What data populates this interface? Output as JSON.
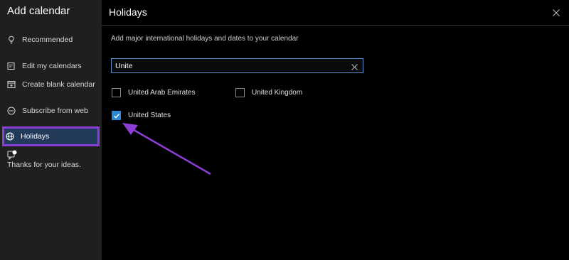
{
  "sidebar": {
    "title": "Add calendar",
    "items": [
      {
        "label": "Recommended",
        "icon": "lightbulb-icon"
      },
      {
        "label": "Edit my calendars",
        "icon": "edit-calendar-icon"
      },
      {
        "label": "Create blank calendar",
        "icon": "blank-calendar-icon"
      },
      {
        "label": "Subscribe from web",
        "icon": "subscribe-icon"
      },
      {
        "label": "Holidays",
        "icon": "globe-icon",
        "active": true
      }
    ],
    "feedback_text": "Thanks for your ideas."
  },
  "main": {
    "title": "Holidays",
    "description": "Add major international holidays and dates to your calendar",
    "search": {
      "value": "Unite"
    },
    "options": [
      {
        "label": "United Arab Emirates",
        "checked": false
      },
      {
        "label": "United Kingdom",
        "checked": false
      },
      {
        "label": "United States",
        "checked": true
      }
    ]
  },
  "colors": {
    "accent": "#2b88d8",
    "highlight_border": "#8c3fd6",
    "active_bg": "#243a5a",
    "annotation_arrow": "#8c3fd6"
  }
}
